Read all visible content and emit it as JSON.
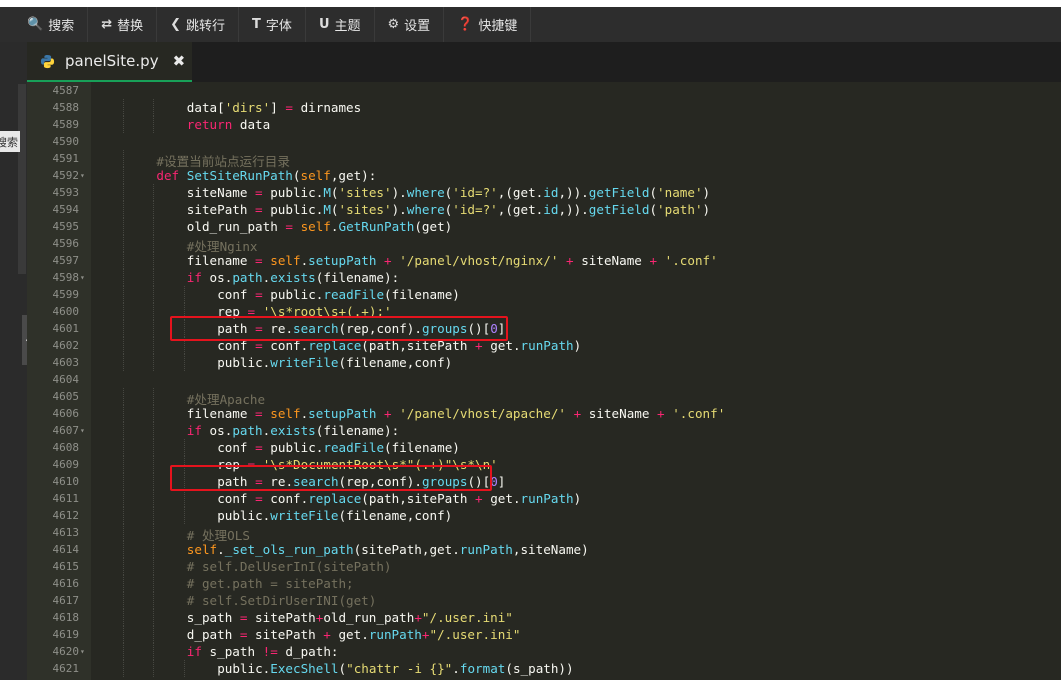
{
  "toolbar": {
    "buttons": [
      {
        "icon": "search-icon",
        "glyph": "🔍",
        "label": "搜索"
      },
      {
        "icon": "replace-icon",
        "glyph": "⇄",
        "label": "替换"
      },
      {
        "icon": "pin-icon",
        "glyph": "✎",
        "label": "跳转行"
      },
      {
        "icon": "font-icon",
        "glyph": "T",
        "label": "字体"
      },
      {
        "icon": "theme-icon",
        "glyph": "U",
        "label": "主题"
      },
      {
        "icon": "gear-icon",
        "glyph": "⚙",
        "label": "设置"
      },
      {
        "icon": "help-icon",
        "glyph": "?",
        "label": "快捷键"
      }
    ]
  },
  "sidebar": {
    "search_label": "搜索",
    "collapse_glyph": "<"
  },
  "tab": {
    "filename": "panelSite.py",
    "close_glyph": "✖",
    "icon": "python-icon"
  },
  "lines": [
    {
      "n": "4587",
      "code": ""
    },
    {
      "n": "4588",
      "code": "data['dirs'] = dirnames"
    },
    {
      "n": "4589",
      "code": "return data"
    },
    {
      "n": "4590",
      "code": ""
    },
    {
      "n": "4591",
      "code": "#设置当前站点运行目录"
    },
    {
      "n": "4592",
      "code": "def SetSiteRunPath(self,get):",
      "fold": true
    },
    {
      "n": "4593",
      "code": "siteName = public.M('sites').where('id=?',(get.id,)).getField('name')"
    },
    {
      "n": "4594",
      "code": "sitePath = public.M('sites').where('id=?',(get.id,)).getField('path')"
    },
    {
      "n": "4595",
      "code": "old_run_path = self.GetRunPath(get)"
    },
    {
      "n": "4596",
      "code": "#处理Nginx"
    },
    {
      "n": "4597",
      "code": "filename = self.setupPath + '/panel/vhost/nginx/' + siteName + '.conf'"
    },
    {
      "n": "4598",
      "code": "if os.path.exists(filename):",
      "fold": true
    },
    {
      "n": "4599",
      "code": "conf = public.readFile(filename)"
    },
    {
      "n": "4600",
      "code": "rep = '\\s*root\\s+(.+);'"
    },
    {
      "n": "4601",
      "code": "path = re.search(rep,conf).groups()[0]"
    },
    {
      "n": "4602",
      "code": "conf = conf.replace(path,sitePath + get.runPath)"
    },
    {
      "n": "4603",
      "code": "public.writeFile(filename,conf)"
    },
    {
      "n": "4604",
      "code": ""
    },
    {
      "n": "4605",
      "code": "#处理Apache"
    },
    {
      "n": "4606",
      "code": "filename = self.setupPath + '/panel/vhost/apache/' + siteName + '.conf'"
    },
    {
      "n": "4607",
      "code": "if os.path.exists(filename):",
      "fold": true
    },
    {
      "n": "4608",
      "code": "conf = public.readFile(filename)"
    },
    {
      "n": "4609",
      "code": "rep = '\\s*DocumentRoot\\s*\"(.+)\"\\s*\\n'"
    },
    {
      "n": "4610",
      "code": "path = re.search(rep,conf).groups()[0]"
    },
    {
      "n": "4611",
      "code": "conf = conf.replace(path,sitePath + get.runPath)"
    },
    {
      "n": "4612",
      "code": "public.writeFile(filename,conf)"
    },
    {
      "n": "4613",
      "code": "# 处理OLS"
    },
    {
      "n": "4614",
      "code": "self._set_ols_run_path(sitePath,get.runPath,siteName)"
    },
    {
      "n": "4615",
      "code": "# self.DelUserInI(sitePath)"
    },
    {
      "n": "4616",
      "code": "# get.path = sitePath;"
    },
    {
      "n": "4617",
      "code": "# self.SetDirUserINI(get)"
    },
    {
      "n": "4618",
      "code": "s_path = sitePath+old_run_path+\"/.user.ini\""
    },
    {
      "n": "4619",
      "code": "d_path = sitePath + get.runPath+\"/.user.ini\""
    },
    {
      "n": "4620",
      "code": "if s_path != d_path:",
      "fold": true
    },
    {
      "n": "4621",
      "code": "public.ExecShell(\"chattr -i {}\".format(s_path))"
    }
  ],
  "colors": {
    "keyword": "#f92672",
    "string": "#e6db74",
    "function": "#66d9ef",
    "comment": "#75715e",
    "self": "#fd971f",
    "number": "#ae81ff",
    "highlight_box": "#e5131d",
    "tab_accent": "#18a058"
  }
}
